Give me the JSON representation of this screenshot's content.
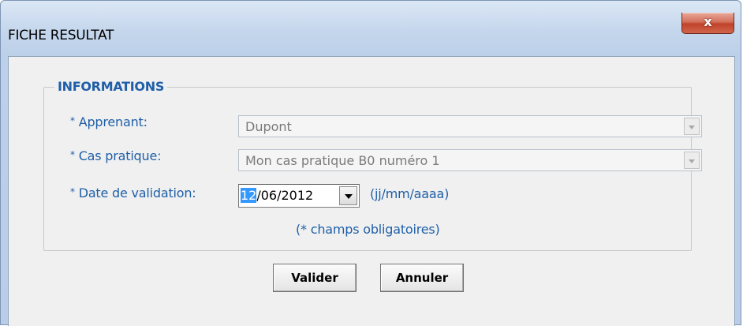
{
  "window": {
    "title": "FICHE RESULTAT",
    "close_glyph": "x"
  },
  "group": {
    "legend": "INFORMATIONS"
  },
  "fields": {
    "required_marker": "*",
    "apprenant": {
      "label": "Apprenant:",
      "value": "Dupont"
    },
    "cas_pratique": {
      "label": "Cas pratique:",
      "value": "Mon cas pratique B0 numéro 1"
    },
    "date_validation": {
      "label": "Date de validation:",
      "day": "12",
      "rest": "/06/2012",
      "format_hint": "(jj/mm/aaaa)"
    },
    "required_note": "(* champs obligatoires)"
  },
  "buttons": {
    "validate": "Valider",
    "cancel": "Annuler"
  },
  "icons": {
    "close": "close-icon",
    "dropdown": "chevron-down-icon"
  }
}
